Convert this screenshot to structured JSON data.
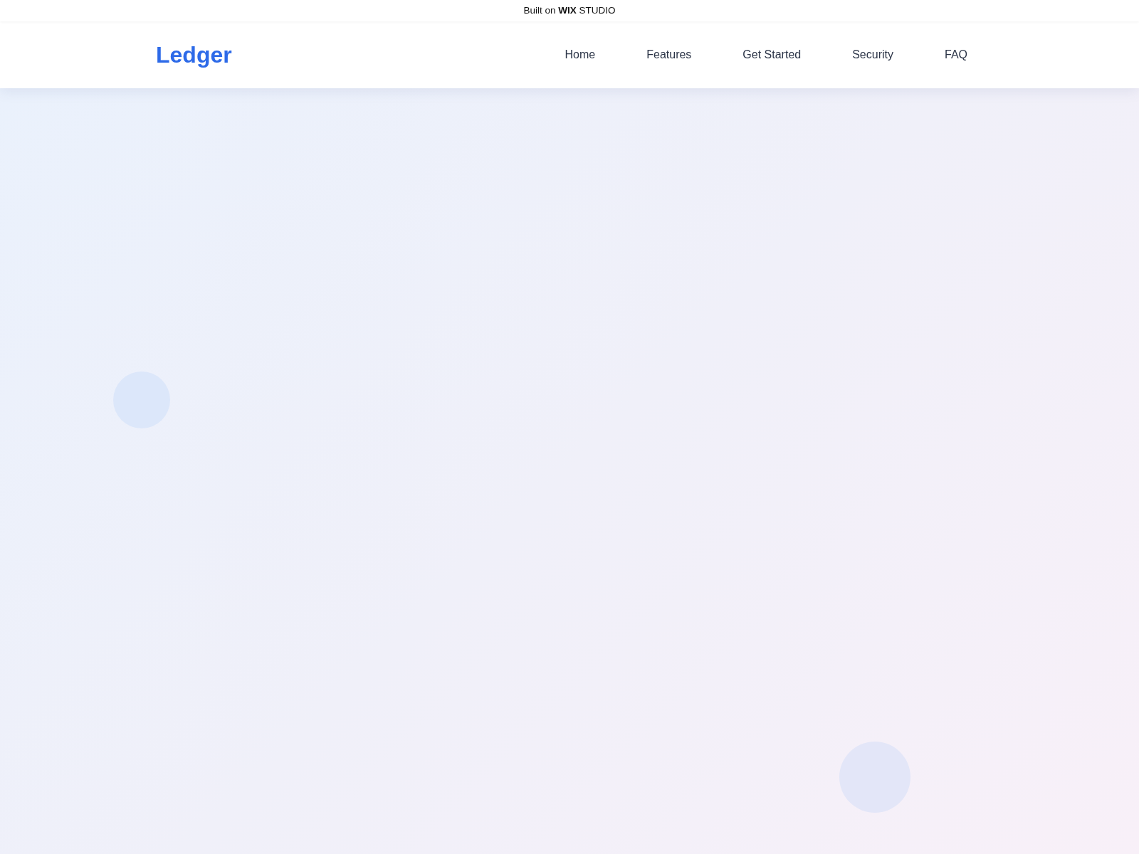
{
  "top_banner": {
    "text": "Built on **WIX** STUDIO"
  },
  "header": {
    "logo": "Ledger",
    "nav": [
      {
        "label": "Home"
      },
      {
        "label": "Features"
      },
      {
        "label": "Get Started"
      },
      {
        "label": "Security"
      },
      {
        "label": "FAQ"
      }
    ]
  }
}
